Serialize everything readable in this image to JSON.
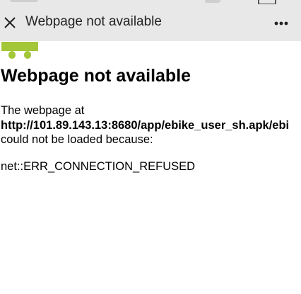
{
  "toolbar": {
    "title": "Webpage not available"
  },
  "error_page": {
    "heading": "Webpage not available",
    "intro": "The webpage at",
    "url": "http://101.89.143.13:8680/app/ebike_user_sh.apk/ebi",
    "reason": "could not be loaded because:",
    "error_code": "net::ERR_CONNECTION_REFUSED"
  },
  "colors": {
    "toolbar_bg": "#e8e8e8",
    "android_green": "#a4c639",
    "text": "#000000"
  }
}
